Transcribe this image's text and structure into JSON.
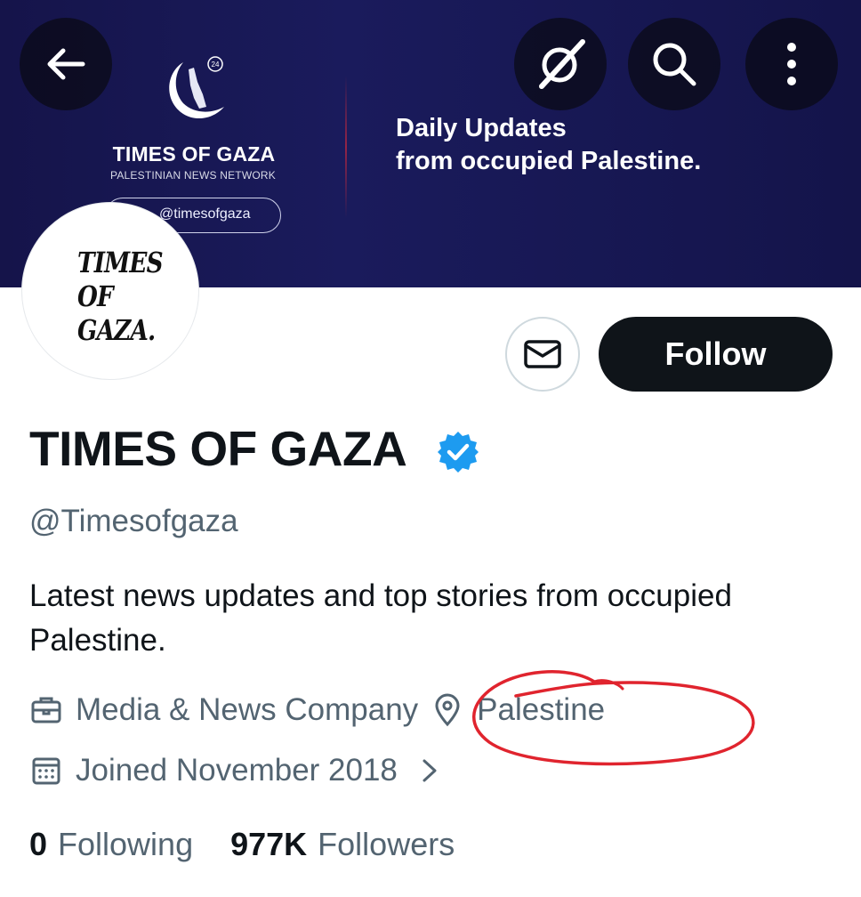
{
  "banner": {
    "badge": "24",
    "brand": "TIMES OF GAZA",
    "subtitle": "PALESTINIAN NEWS NETWORK",
    "handle": "@timesofgaza",
    "tagline_line1": "Daily Updates",
    "tagline_line2": "from occupied Palestine."
  },
  "nav": {
    "back_icon": "arrow-left-icon",
    "grok_icon": "grok-icon",
    "search_icon": "search-icon",
    "more_icon": "more-vertical-icon"
  },
  "avatar": {
    "line1": "TIMES",
    "line2": "OF",
    "line3": "GAZA."
  },
  "actions": {
    "message_icon": "envelope-icon",
    "follow_label": "Follow"
  },
  "profile": {
    "display_name": "TIMES OF GAZA",
    "handle": "@Timesofgaza",
    "bio": "Latest news updates and top stories from occupied Palestine.",
    "category": "Media & News Company",
    "location": "Palestine",
    "joined": "Joined November 2018",
    "verified_color": "#1d9bf0"
  },
  "stats": {
    "following_count": "0",
    "following_label": "Following",
    "followers_count": "977K",
    "followers_label": "Followers"
  },
  "annotation_color": "#e0242e"
}
